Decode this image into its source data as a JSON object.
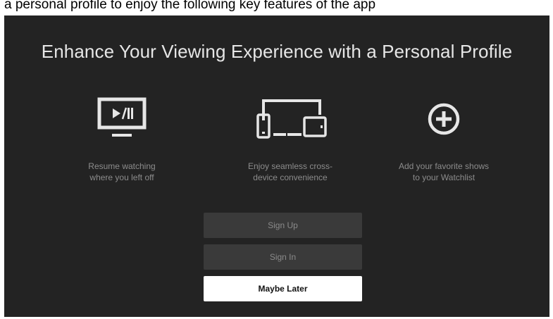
{
  "top_caption": "a personal profile to enjoy the following key features of the app",
  "headline": "Enhance Your Viewing Experience with a Personal Profile",
  "features": [
    {
      "icon": "tv-play-pause-icon",
      "line1": "Resume watching",
      "line2": "where you left off"
    },
    {
      "icon": "multi-device-icon",
      "line1": "Enjoy seamless cross-",
      "line2": "device convenience"
    },
    {
      "icon": "plus-circle-icon",
      "line1": "Add your favorite shows",
      "line2": "to your Watchlist"
    }
  ],
  "buttons": {
    "sign_up": "Sign Up",
    "sign_in": "Sign In",
    "maybe_later": "Maybe Later"
  },
  "colors": {
    "background": "#232323",
    "button_dark": "#3a3a3a",
    "button_light": "#ffffff",
    "icon": "#e6e6e6"
  }
}
